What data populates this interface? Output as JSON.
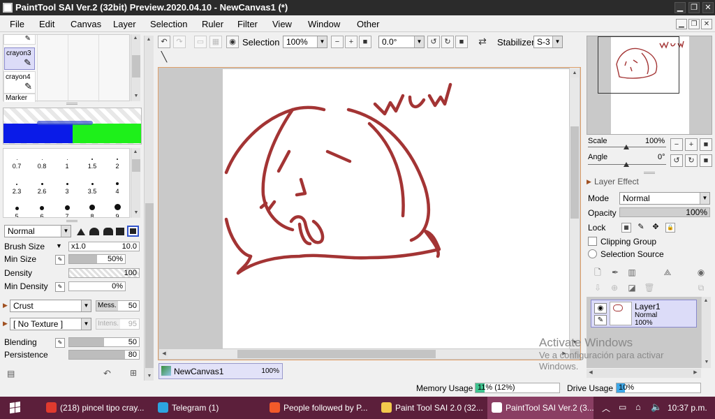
{
  "window": {
    "title": "PaintTool SAI Ver.2 (32bit) Preview.2020.04.10 - NewCanvas1 (*)",
    "controls": {
      "minimize": "▁",
      "restore": "❐",
      "close": "✕"
    }
  },
  "menu": {
    "items": [
      "File",
      "Edit",
      "Canvas",
      "Layer",
      "Selection",
      "Ruler",
      "Filter",
      "View",
      "Window",
      "Other"
    ]
  },
  "tools": {
    "slots": [
      {
        "label": "crayon3"
      },
      {
        "label": "crayon4"
      },
      {
        "label": "Marker"
      }
    ]
  },
  "brush_sizes": {
    "cells": [
      "0.7",
      "0.8",
      "1",
      "1.5",
      "2",
      "2.3",
      "2.6",
      "3",
      "3.5",
      "4",
      "5",
      "6",
      "7",
      "8",
      "9"
    ]
  },
  "brush": {
    "blend_mode": "Normal",
    "size_label": "Brush Size",
    "size_multiplier": "x1.0",
    "size_value": "10.0",
    "min_size_label": "Min Size",
    "min_size_value": "50%",
    "min_size_fraction": 0.5,
    "density_label": "Density",
    "density_value": "100",
    "min_density_label": "Min Density",
    "min_density_value": "0%",
    "shape": "Crust",
    "mess_label": "Mess.",
    "mess_value": "50",
    "texture": "[ No Texture ]",
    "intens_label": "Intens.",
    "intens_value": "95",
    "blending_label": "Blending",
    "blending_value": "50",
    "blending_fraction": 0.5,
    "persistence_label": "Persistence",
    "persistence_value": "80",
    "persistence_fraction": 0.8
  },
  "toolbar": {
    "selection_label": "Selection",
    "zoom_value": "100%",
    "rotation_value": "0.0°",
    "stabilizer_label": "Stabilizer",
    "stabilizer_value": "S-3"
  },
  "canvas": {
    "doodle_text": "WUV",
    "stroke_color": "#a33434"
  },
  "document_tab": {
    "name": "NewCanvas1",
    "zoom": "100%"
  },
  "status": {
    "memory_label": "Memory Usage",
    "memory_value": "11% (12%)",
    "memory_fraction": 0.11,
    "drive_label": "Drive Usage",
    "drive_value": "10%",
    "drive_fraction": 0.1
  },
  "navigator": {
    "scale_label": "Scale",
    "scale_value": "100%",
    "angle_label": "Angle",
    "angle_value": "0°"
  },
  "layer_effect": {
    "header": "Layer Effect",
    "mode_label": "Mode",
    "mode_value": "Normal",
    "opacity_label": "Opacity",
    "opacity_value": "100%",
    "lock_label": "Lock",
    "clipping_group_label": "Clipping Group",
    "selection_source_label": "Selection Source"
  },
  "layers": [
    {
      "name": "Layer1",
      "mode": "Normal",
      "opacity": "100%"
    }
  ],
  "watermark": {
    "line1": "Activate Windows",
    "line2": "Ve a configuración para activar",
    "line3": "Windows."
  },
  "taskbar": {
    "tasks": [
      {
        "label": "(218) pincel tipo cray...",
        "color": "#e03a2e"
      },
      {
        "label": "Telegram (1)",
        "color": "#2ca5e0"
      },
      {
        "label": "People followed by P...",
        "color": "#f25a2a"
      },
      {
        "label": "Paint Tool SAI 2.0 (32...",
        "color": "#f2c94c"
      },
      {
        "label": "PaintTool SAI Ver.2 (3...",
        "color": "#ffffff"
      }
    ],
    "time": "10:37 p.m."
  },
  "colors": {
    "accent_selection": "#e2e2f8",
    "taskbar": "#5c1f3b",
    "titlebar": "#2b2b2b"
  }
}
